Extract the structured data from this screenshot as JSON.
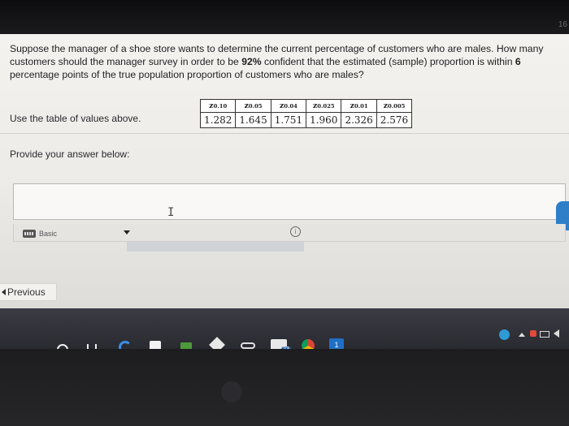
{
  "page_corner_number": "16",
  "question": {
    "text_before_conf": "Suppose the manager of a shoe store wants to determine the current percentage of customers who are males. How many customers should the manager survey in order to be ",
    "confidence": "92%",
    "text_after_conf": " confident that the estimated (sample) proportion is within ",
    "within": "6",
    "text_end": " percentage points of the true population proportion of customers who are males?"
  },
  "z_table": {
    "z_letter": "z",
    "headers": [
      "0.10",
      "0.05",
      "0.04",
      "0.025",
      "0.01",
      "0.005"
    ],
    "values": [
      "1.282",
      "1.645",
      "1.751",
      "1.960",
      "2.326",
      "2.576"
    ]
  },
  "instruction": "Use the table of values above.",
  "answer_prompt": "Provide your answer below:",
  "answer": {
    "value": "",
    "cursor": "I"
  },
  "editor": {
    "mode_label": "Basic",
    "info_glyph": "i"
  },
  "nav": {
    "previous_label": "Previous"
  },
  "taskbar": {
    "badge": "23",
    "mail_count": "1"
  },
  "colors": {
    "accent_blue": "#2f7fc8",
    "taskbar": "#33333b",
    "text": "#1f1f22"
  }
}
